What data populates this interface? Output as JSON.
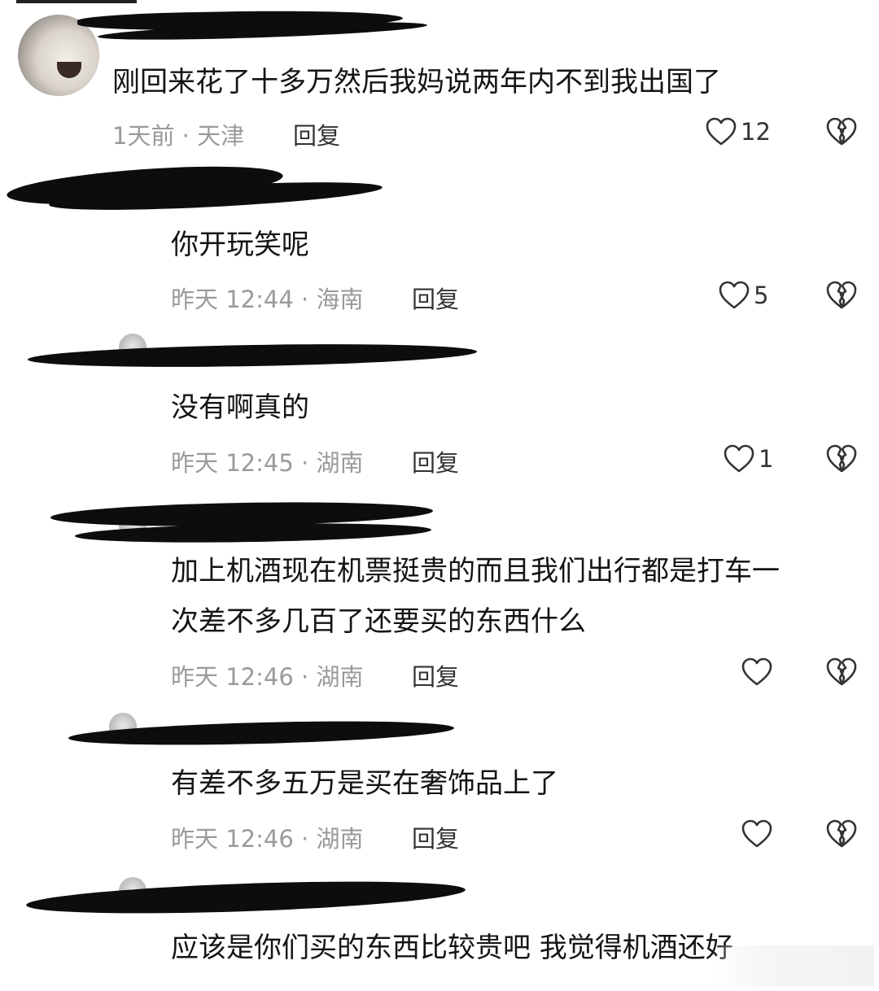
{
  "comments": [
    {
      "text": "刚回来花了十多万然后我妈说两年内不到我出国了",
      "meta": "1天前 · 天津",
      "reply_label": "回复",
      "likes": "12"
    },
    {
      "text": "你开玩笑呢",
      "meta": "昨天 12:44 · 海南",
      "reply_label": "回复",
      "likes": "5"
    },
    {
      "text": "没有啊真的",
      "meta": "昨天 12:45 · 湖南",
      "reply_label": "回复",
      "likes": "1"
    },
    {
      "text_line1": "加上机酒现在机票挺贵的而且我们出行都是打车一",
      "text_line2": "次差不多几百了还要买的东西什么",
      "meta": "昨天 12:46 · 湖南",
      "reply_label": "回复",
      "likes": ""
    },
    {
      "text": "有差不多五万是买在奢饰品上了",
      "meta": "昨天 12:46 · 湖南",
      "reply_label": "回复",
      "likes": ""
    },
    {
      "text": "应该是你们买的东西比较贵吧 我觉得机酒还好"
    }
  ],
  "icons": {
    "like": "heart-outline-icon",
    "dislike": "broken-heart-icon"
  },
  "colors": {
    "text": "#141414",
    "meta": "#9a9a9a",
    "redaction": "#0d0d0d"
  }
}
